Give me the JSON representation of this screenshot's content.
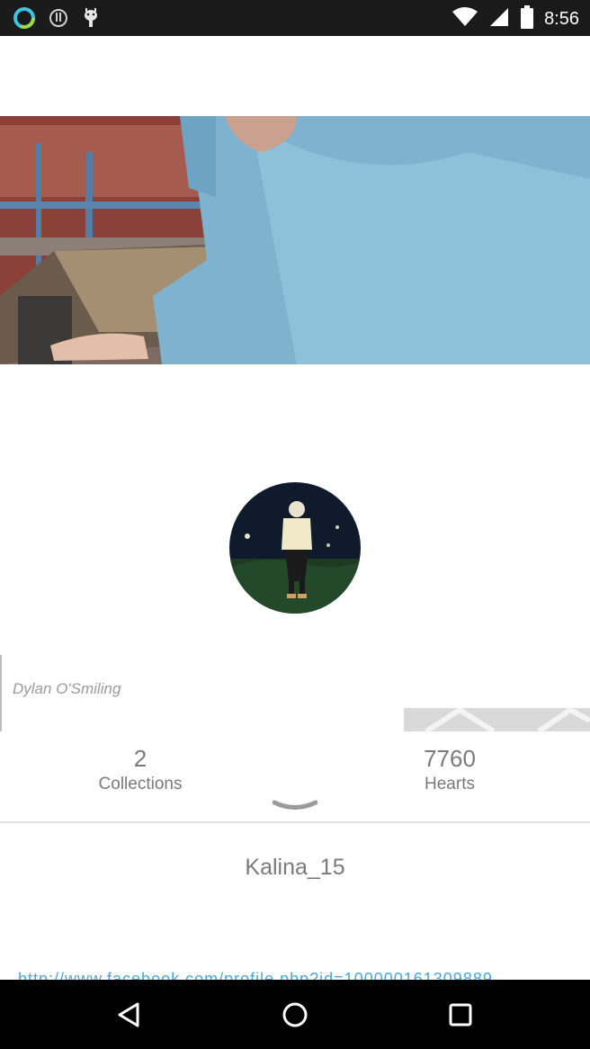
{
  "status_bar": {
    "time": "8:56",
    "icons": [
      "ring-notification-icon",
      "alert-circle-icon",
      "android-debug-icon",
      "wifi-icon",
      "signal-icon",
      "battery-icon"
    ]
  },
  "profile": {
    "display_name": "Dylan O'Smiling",
    "username": "Kalina_15",
    "link_text": "http://www.facebook.com/profile.php?id=100000161309889"
  },
  "stats": {
    "collections": {
      "value": "2",
      "label": "Collections"
    },
    "hearts": {
      "value": "7760",
      "label": "Hearts"
    }
  },
  "colors": {
    "status_bar_bg": "#1a1a1a",
    "nav_bar_bg": "#000000",
    "text_gray": "#7a7a7a",
    "link_blue": "#4aa7d8"
  },
  "nav_bar": {
    "icons": [
      "back-icon",
      "home-icon",
      "recents-icon"
    ]
  }
}
